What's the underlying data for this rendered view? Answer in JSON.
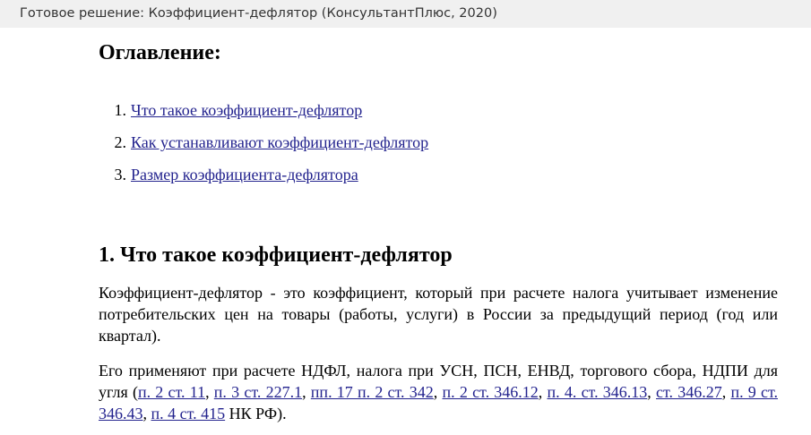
{
  "header": {
    "title": "Готовое решение: Коэффициент-дефлятор (КонсультантПлюс, 2020)"
  },
  "toc": {
    "heading": "Оглавление:",
    "items": [
      {
        "num": "1.",
        "label": "Что такое коэффициент-дефлятор"
      },
      {
        "num": "2.",
        "label": "Как устанавливают коэффициент-дефлятор"
      },
      {
        "num": "3.",
        "label": "Размер коэффициента-дефлятора"
      }
    ]
  },
  "section1": {
    "heading": "1. Что такое коэффициент-дефлятор",
    "para1": "Коэффициент-дефлятор - это коэффициент, который при расчете налога учитывает изменение потребительских цен на товары (работы, услуги) в России за предыдущий период (год или квартал).",
    "para2_prefix": "Его применяют при расчете НДФЛ, налога при УСН, ПСН, ЕНВД, торгового сбора, НДПИ для угля (",
    "links": [
      "п. 2 ст. 11",
      "п. 3 ст. 227.1",
      "пп. 17 п. 2 ст. 342",
      "п. 2 ст. 346.12",
      "п. 4. ст. 346.13",
      "ст. 346.27",
      "п. 9 ст. 346.43",
      "п. 4 ст. 415"
    ],
    "separator": ", ",
    "para2_suffix": " НК РФ)."
  },
  "colors": {
    "link": "#23238e",
    "topbar_bg": "#f0f0f0"
  }
}
